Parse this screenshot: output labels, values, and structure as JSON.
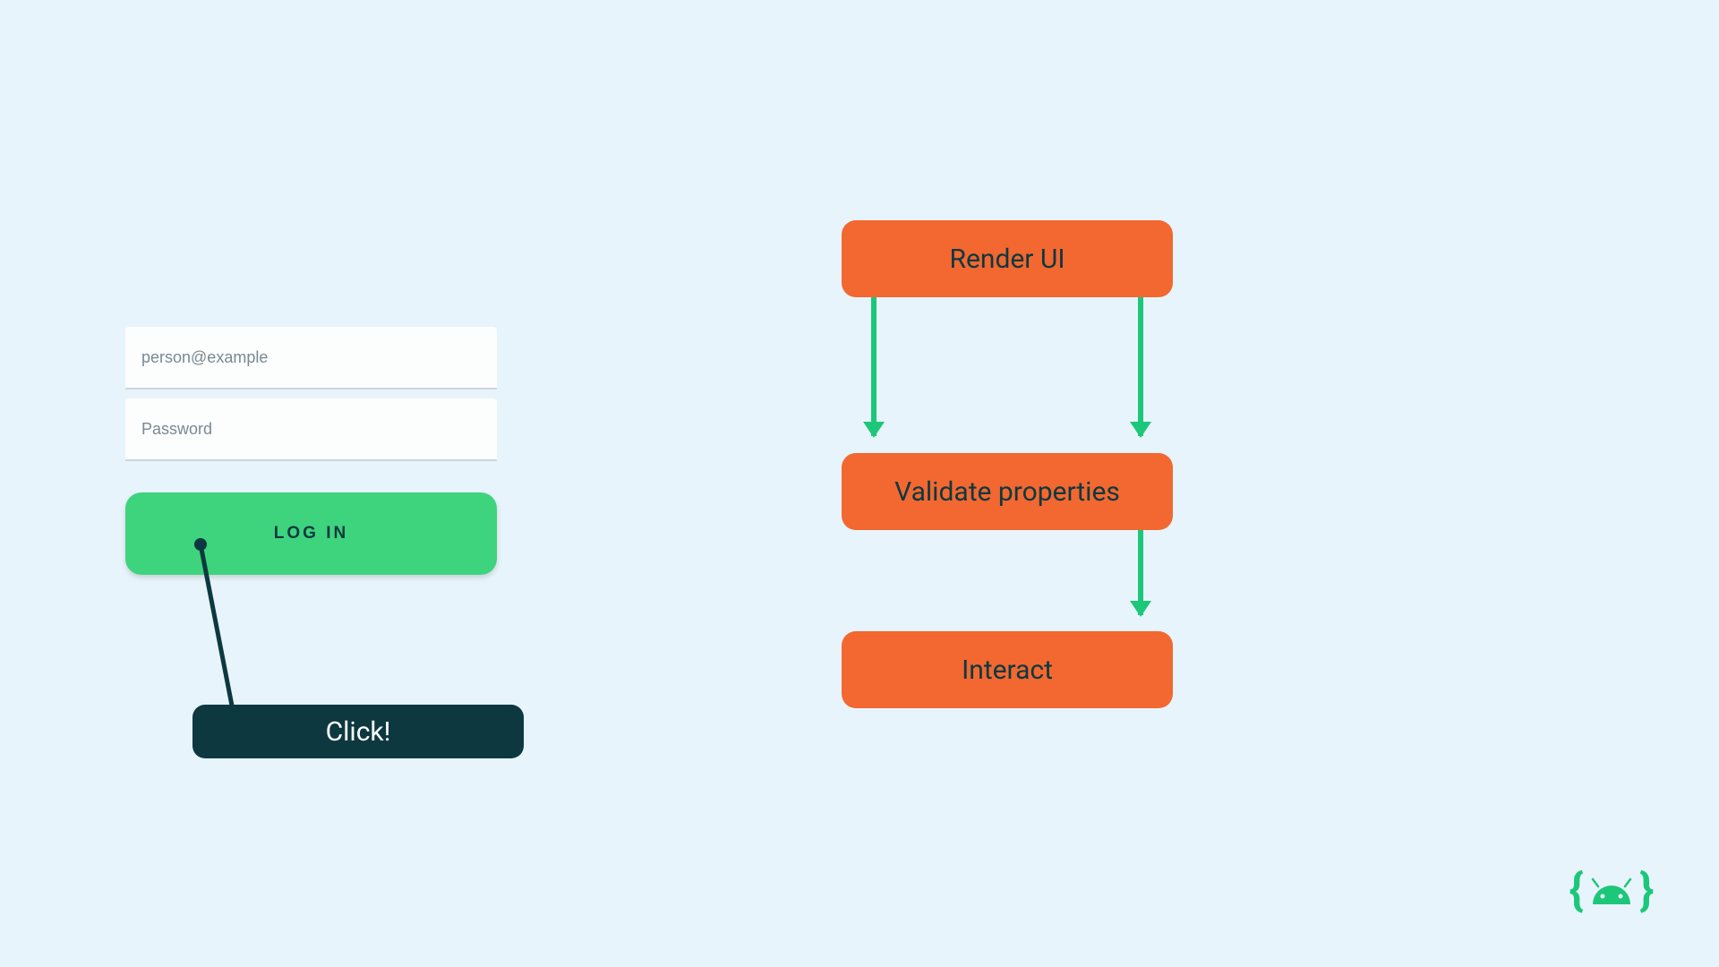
{
  "form": {
    "email_placeholder": "person@example",
    "password_placeholder": "Password",
    "login_button_label": "LOG IN"
  },
  "callout": {
    "label": "Click!"
  },
  "flow": {
    "step1": "Render UI",
    "step2": "Validate properties",
    "step3": "Interact"
  },
  "colors": {
    "background": "#e8f4fb",
    "orange": "#f26830",
    "green": "#3dd47d",
    "arrow_green": "#1cc77a",
    "dark": "#0d3840"
  }
}
